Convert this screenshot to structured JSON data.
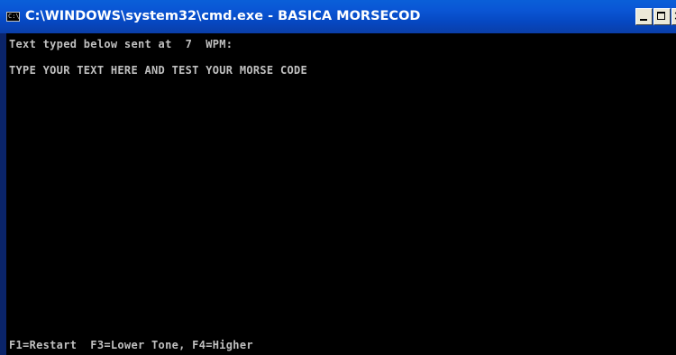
{
  "window": {
    "title": "C:\\WINDOWS\\system32\\cmd.exe - BASICA MORSECOD",
    "icon": "console-app-icon",
    "icon_glyph": "C:\\",
    "controls": {
      "minimize_icon": "minimize-icon",
      "maximize_icon": "maximize-icon",
      "close_icon": "close-icon",
      "close_glyph": "×"
    }
  },
  "console": {
    "lines": [
      "Text typed below sent at  7  WPM:",
      "TYPE YOUR TEXT HERE AND TEST YOUR MORSE CODE"
    ],
    "footer": "F1=Restart  F3=Lower Tone, F4=Higher"
  },
  "colors": {
    "titlebar": "#0a56d5",
    "console_bg": "#000000",
    "console_text": "#c0c0c0"
  }
}
